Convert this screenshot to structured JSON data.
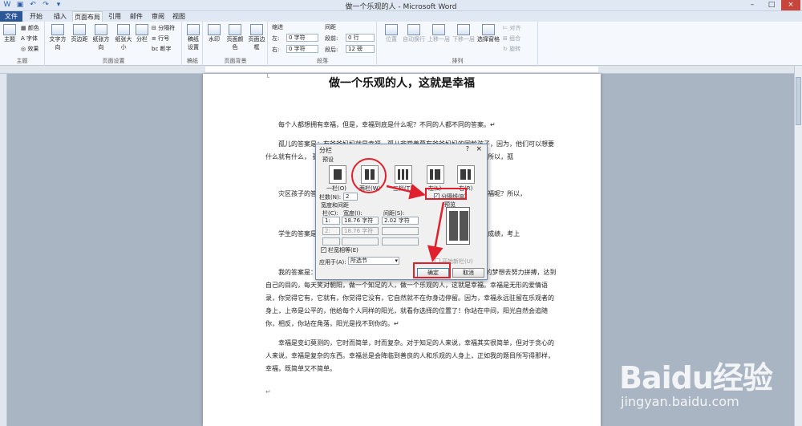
{
  "window": {
    "title": "做一个乐观的人 - Microsoft Word",
    "controls": [
      "–",
      "□",
      "×"
    ]
  },
  "tabs": [
    {
      "label": "文件"
    },
    {
      "label": "开始"
    },
    {
      "label": "插入"
    },
    {
      "label": "页面布局"
    },
    {
      "label": "引用"
    },
    {
      "label": "邮件"
    },
    {
      "label": "审阅"
    },
    {
      "label": "视图"
    }
  ],
  "ribbon": {
    "theme_group": {
      "label": "主题",
      "big": "主题",
      "small": [
        "颜色",
        "字体",
        "效果"
      ]
    },
    "pagesetup_group": {
      "label": "页面设置",
      "buttons": [
        "文字方向",
        "页边距",
        "纸张方向",
        "纸张大小",
        "分栏"
      ],
      "small": [
        "分隔符",
        "行号",
        "断字"
      ]
    },
    "draft_group": {
      "label": "稿纸",
      "button": "稿纸\n设置"
    },
    "background_group": {
      "label": "页面背景",
      "buttons": [
        "水印",
        "页面颜色",
        "页面边框"
      ]
    },
    "paragraph_group": {
      "label": "段落",
      "indent_header": "缩进",
      "spacing_header": "间距",
      "left_label": "左:",
      "left_value": "0 字符",
      "right_label": "右:",
      "right_value": "0 字符",
      "before_label": "段前:",
      "before_value": "0 行",
      "after_label": "段后:",
      "after_value": "12 磅"
    },
    "arrange_group": {
      "label": "排列",
      "buttons": [
        "位置",
        "自动换行",
        "上移一层",
        "下移一层",
        "选择窗格"
      ],
      "small": [
        "对齐",
        "组合",
        "旋转"
      ]
    }
  },
  "document": {
    "title": "做一个乐观的人，这就是幸福",
    "paragraphs": [
      "每个人都想拥有幸福，但是，幸福到底是什么呢？不同的人都不同的答案。↵",
      "孤儿的答案是：有爸爸妈妈就是幸福。孤儿非常羡慕有爸爸妈妈的同龄孩子，因为，他们可以想要什么就有什么，                                  孤儿没有爸爸妈妈的保护，经常受到                                                    得到他们想要的东西了！所以，孤",
      "灾区孩子的答                                                     们的家园，这些孩子因此没有了家，                                                    的孩子该怎么谈得上幸福呢？所以，",
      "学生的答案是                                                       莘莘学子都渴望自己的努力得到回报                                                   学生来说，取得理想的成绩，考上",
      "我的答案是：                                                         拥当下所拥有的一切，不贪心，不贪图一切利益，为了自己的梦想去努力拼搏，达到自己的目的，每天笑对朝阳，做一个知足的人，做一个乐观的人，这就是幸福。幸福是无形的爱情语录，你觉得它有，它就有，你觉得它没有，它自然就不在你身边停留。因为，幸福永远驻留在乐观者的身上，上帝是公平的，他给每个人同样的阳光，就看你选择的位置了！你站在中间，阳光自然会追随你，相反，你站在角落，阳光是找不到你的。↵",
      "幸福是变幻莫测的，它时而简单，时而复杂。对于知足的人来说，幸福其实很简单，但对于贪心的人来说，幸福是复杂的东西。幸福总是会降临到善良的人和乐观的人身上，正如我的题目所写得那样，幸福，既简单又不简单。"
    ],
    "end_mark": "↵"
  },
  "dialog": {
    "title": "分栏",
    "help": "?",
    "close": "×",
    "preset_header": "预设",
    "presets": [
      {
        "label": "一栏(O)",
        "cols": 1
      },
      {
        "label": "两栏(W)",
        "cols": 2
      },
      {
        "label": "三栏(T)",
        "cols": 3
      },
      {
        "label": "左(L)",
        "cols": 2
      },
      {
        "label": "右(R)",
        "cols": 2
      }
    ],
    "num_cols_label": "栏数(N):",
    "num_cols_value": "2",
    "separator_label": "分隔线(B)",
    "width_spacing_header": "宽度和间距",
    "col_header": "栏(C):",
    "width_header": "宽度(I):",
    "spacing_header": "间距(S):",
    "rows": [
      {
        "num": "1:",
        "width": "18.76 字符",
        "spacing": "2.02 字符"
      },
      {
        "num": "2:",
        "width": "18.76 字符",
        "spacing": ""
      }
    ],
    "equal_width_label": "栏宽相等(E)",
    "apply_label": "应用于(A):",
    "apply_value": "所选节",
    "preview_label": "预览",
    "new_col_label": "开始新栏(U)",
    "ok": "确定",
    "cancel": "取消"
  },
  "watermark": {
    "brand": "Baidu经验",
    "url": "jingyan.baidu.com"
  }
}
